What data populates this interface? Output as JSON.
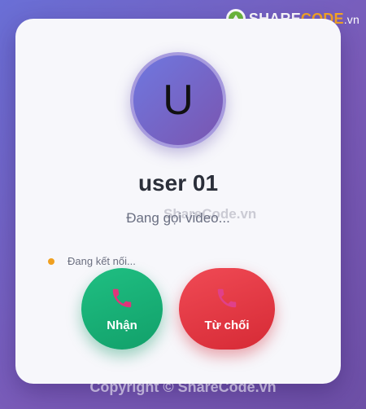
{
  "caller": {
    "avatar_letter": "U",
    "name": "user 01",
    "status": "Đang gọi video..."
  },
  "connection": {
    "text": "Đang kết nối...",
    "dot_color": "#f0a020"
  },
  "actions": {
    "accept_label": "Nhận",
    "decline_label": "Từ chối",
    "accept_color": "#12a06a",
    "decline_color": "#d62a35",
    "icon": "phone-icon"
  },
  "watermark": {
    "center_text": "ShareCode.vn",
    "logo_prefix": "SHARE",
    "logo_accent": "CODE",
    "logo_tld": ".vn",
    "copyright": "Copyright © ShareCode.vn"
  }
}
